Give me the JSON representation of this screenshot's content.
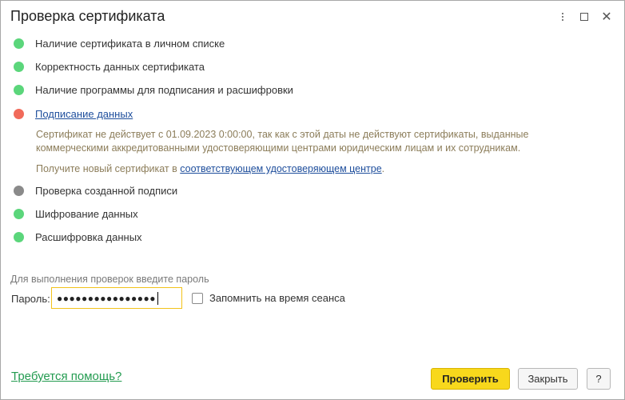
{
  "window": {
    "title": "Проверка сертификата"
  },
  "checks": [
    {
      "label": "Наличие сертификата в личном списке",
      "status": "green"
    },
    {
      "label": "Корректность данных сертификата",
      "status": "green"
    },
    {
      "label": "Наличие программы для подписания и расшифровки",
      "status": "green"
    },
    {
      "label": "Подписание данных",
      "status": "red"
    },
    {
      "label": "Проверка созданной подписи",
      "status": "gray"
    },
    {
      "label": "Шифрование данных",
      "status": "green"
    },
    {
      "label": "Расшифровка данных",
      "status": "green"
    }
  ],
  "signing_error": {
    "line1": "Сертификат не действует с 01.09.2023 0:00:00, так как с этой даты не действуют сертификаты, выданные",
    "line2": "коммерческими аккредитованными удостоверяющими центрами юридическим лицам и их сотрудникам.",
    "hint_prefix": "Получите новый сертификат в ",
    "hint_link": "соответствующем удостоверяющем центре",
    "hint_suffix": "."
  },
  "password": {
    "caption": "Для выполнения проверок введите пароль",
    "label": "Пароль:",
    "masked_value": "●●●●●●●●●●●●●●●●",
    "remember_label": "Запомнить на время сеанса",
    "remember_checked": false
  },
  "footer": {
    "help_link": "Требуется помощь?",
    "check_button": "Проверить",
    "close_button": "Закрыть",
    "help_button": "?"
  },
  "colors": {
    "ok": "#5bd67b",
    "error": "#f16a5a",
    "pending": "#8a8a8a",
    "primary_button": "#f8d81c",
    "focus_border": "#f2c21a"
  }
}
